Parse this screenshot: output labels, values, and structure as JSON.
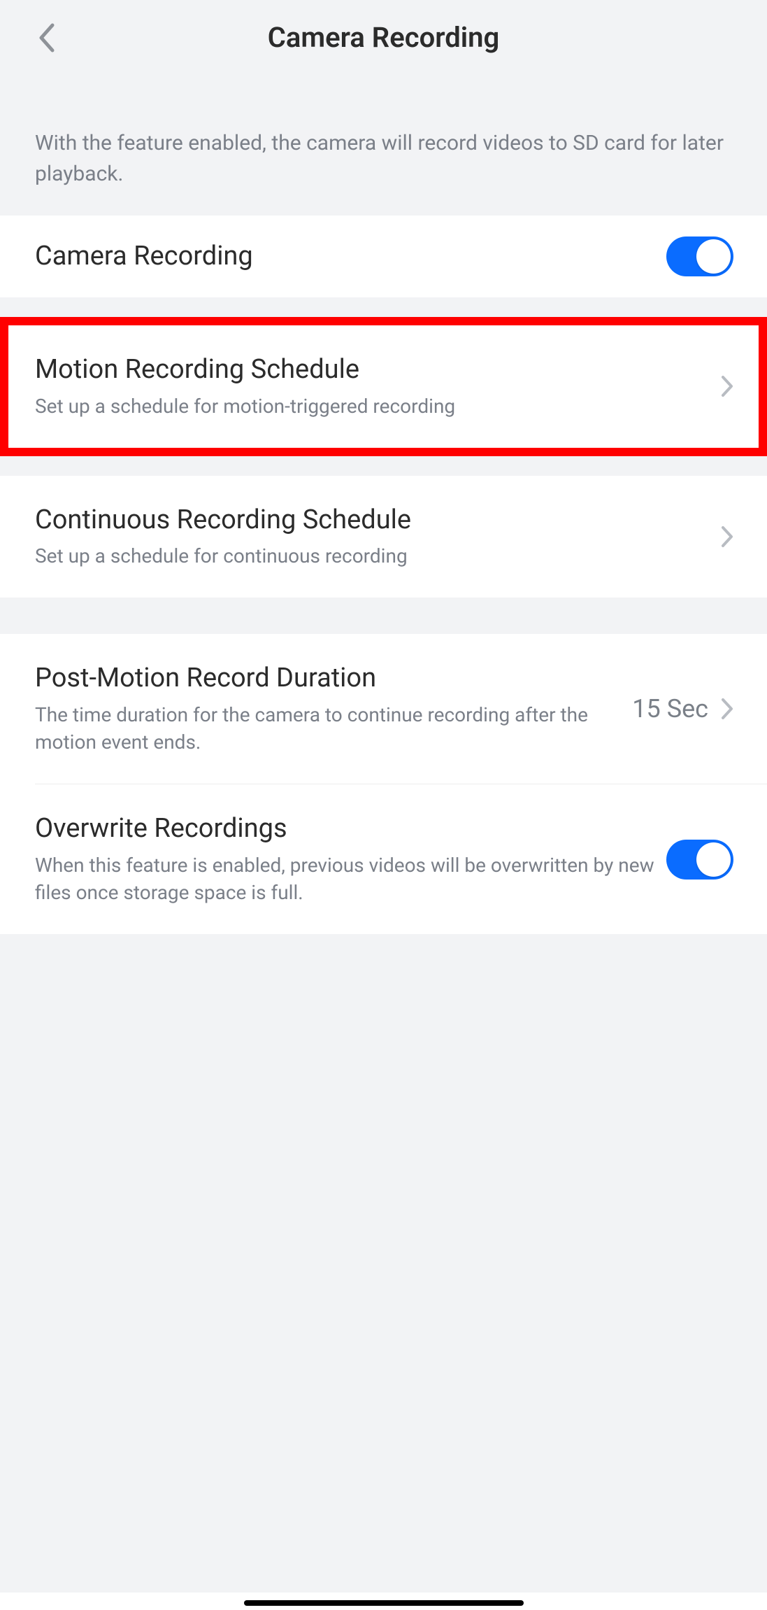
{
  "header": {
    "title": "Camera Recording"
  },
  "description": "With the feature enabled, the camera will record videos to SD card for later playback.",
  "rows": {
    "camera_recording": {
      "title": "Camera Recording",
      "toggle_on": true
    },
    "motion_schedule": {
      "title": "Motion Recording Schedule",
      "sub": "Set up a schedule for motion-triggered recording"
    },
    "continuous_schedule": {
      "title": "Continuous Recording Schedule",
      "sub": "Set up a schedule for continuous recording"
    },
    "post_motion": {
      "title": "Post-Motion Record Duration",
      "sub": "The time duration for the camera to continue recording after the motion event ends.",
      "value": "15 Sec"
    },
    "overwrite": {
      "title": "Overwrite Recordings",
      "sub": "When this feature is enabled, previous videos will be overwritten by new files once storage space is full.",
      "toggle_on": true
    }
  }
}
